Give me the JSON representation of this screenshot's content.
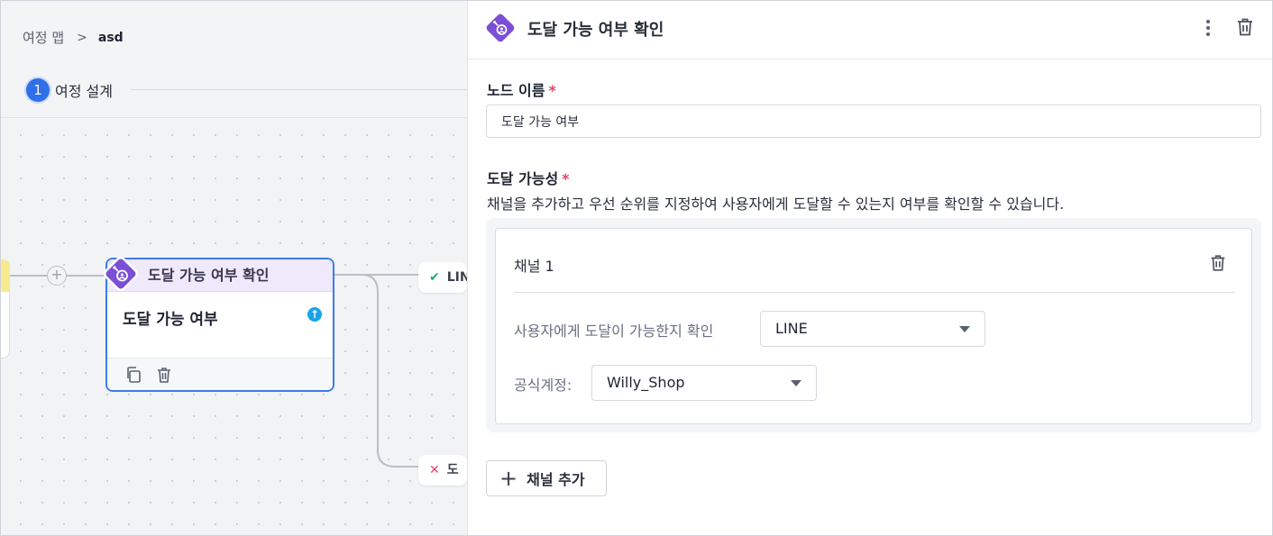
{
  "breadcrumb": {
    "root": "여정 맵",
    "separator": ">",
    "current": "asd"
  },
  "step": {
    "number": "1",
    "label": "여정 설계"
  },
  "canvas": {
    "node": {
      "header": "도달 가능 여부 확인",
      "title": "도달 가능 여부",
      "icon": "reachability-icon"
    },
    "branches": [
      {
        "label": "LINE",
        "status": "success"
      },
      {
        "label": "도달 불가",
        "status": "fail"
      }
    ]
  },
  "panel": {
    "title": "도달 가능 여부 확인",
    "node_name_label": "노드 이름",
    "required_mark": "*",
    "node_name_value": "도달 가능 여부",
    "reachability_label": "도달 가능성",
    "reachability_desc": "채널을 추가하고 우선 순위를 지정하여 사용자에게 도달할 수 있는지 여부를 확인할 수 있습니다.",
    "channel": {
      "title": "채널 1",
      "check_label": "사용자에게 도달이 가능한지 확인",
      "check_value": "LINE",
      "account_label": "공식계정:",
      "account_value": "Willy_Shop"
    },
    "add_channel": "채널 추가"
  },
  "colors": {
    "accent": "#3b7bf0",
    "purple": "#7b4fd6",
    "success": "#16b36a",
    "danger": "#e8436a"
  }
}
